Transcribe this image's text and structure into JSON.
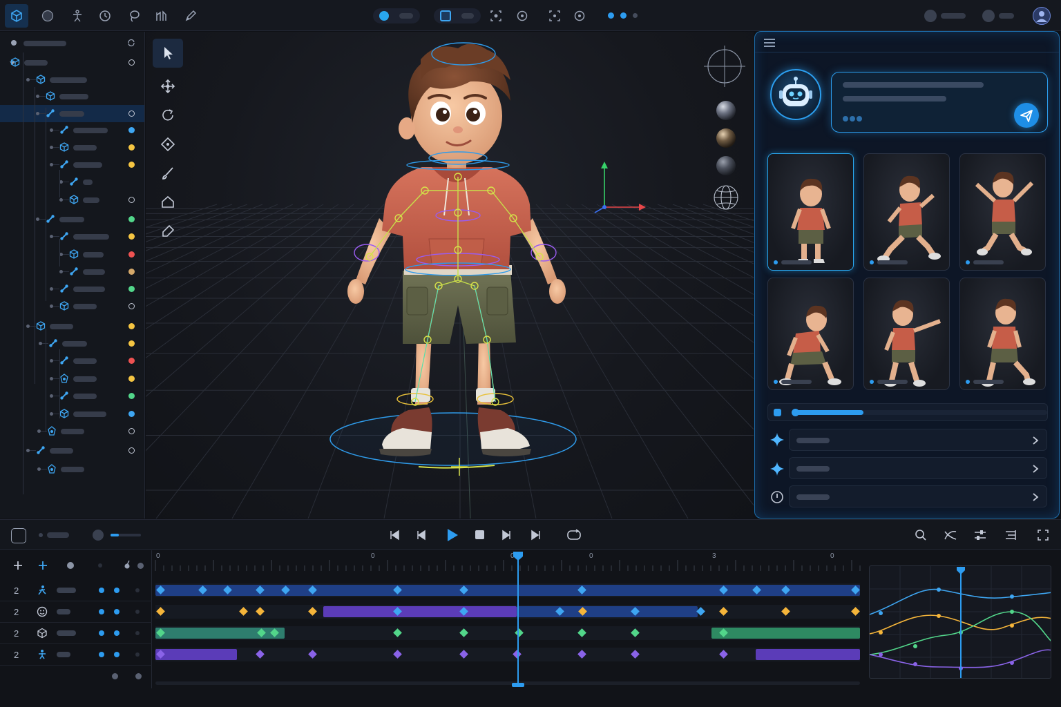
{
  "colors": {
    "accent": "#2d9cf0",
    "key_blue": "#3ea6f2",
    "key_yellow": "#f5b53a",
    "key_green": "#52d68a",
    "key_purple": "#8a63e8",
    "status_red": "#ee5252"
  },
  "toolbar": {
    "icons": [
      "cube-icon",
      "sphere-icon",
      "rig-figure-icon",
      "clock-icon",
      "lasso-icon",
      "graph-icon",
      "pen-icon"
    ],
    "center_icons": [
      "layout-icon",
      "focus-icon",
      "target-icon",
      "snap-icon",
      "record-icon"
    ],
    "right_icons": [
      "user-avatar-icon"
    ]
  },
  "outliner": {
    "status_dots": [
      "white",
      "white",
      "none",
      "none",
      "white",
      "blue",
      "yellow",
      "yellow",
      "none",
      "white",
      "green",
      "yellow",
      "red",
      "tan",
      "green",
      "white",
      "yellow",
      "yellow",
      "red",
      "yellow",
      "green",
      "blue",
      "white",
      "white"
    ]
  },
  "tools": [
    "select-tool",
    "move-tool",
    "rotate-tool",
    "keyframe-tool",
    "brush-tool",
    "home-tool",
    "eraser-tool"
  ],
  "viewport": {
    "shading_modes": [
      "matcap-gray",
      "matcap-bronze",
      "matcap-dark",
      "wireframe-globe"
    ]
  },
  "assistant": {
    "thumbnails": [
      {
        "pose": "standing",
        "selected": true
      },
      {
        "pose": "running",
        "selected": false
      },
      {
        "pose": "jumping",
        "selected": false
      },
      {
        "pose": "crouching",
        "selected": false
      },
      {
        "pose": "pointing",
        "selected": false
      },
      {
        "pose": "kneeling",
        "selected": false
      }
    ],
    "progress": 0.28,
    "actions": [
      "sparkle-icon",
      "sparkle-icon",
      "info-icon"
    ]
  },
  "timeline": {
    "ruler_labels": [
      "0",
      "0",
      "0",
      "0",
      "3",
      "0"
    ],
    "tracks": [
      {
        "number": "2",
        "icon": "run-figure-icon"
      },
      {
        "number": "2",
        "icon": "face-icon"
      },
      {
        "number": "2",
        "icon": "cube-icon"
      },
      {
        "number": "2",
        "icon": "figure-icon"
      }
    ],
    "playhead_fraction": 0.515
  }
}
